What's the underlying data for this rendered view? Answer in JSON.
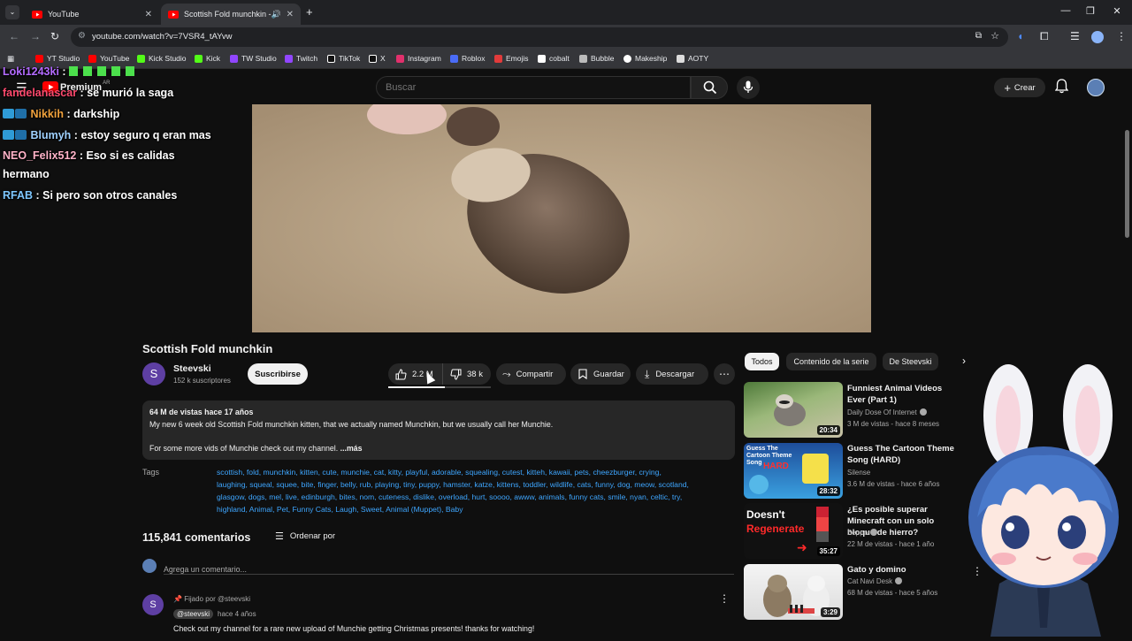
{
  "browser": {
    "tabs": [
      {
        "label": "YouTube"
      },
      {
        "label": "Scottish Fold munchkin - Yo"
      }
    ],
    "url": "youtube.com/watch?v=7VSR4_tAYvw",
    "bookmarks": [
      {
        "label": "YT Studio",
        "color": "#ff0000"
      },
      {
        "label": "YouTube",
        "color": "#ff0000"
      },
      {
        "label": "Kick Studio",
        "color": "#53fc18"
      },
      {
        "label": "Kick",
        "color": "#53fc18"
      },
      {
        "label": "TW Studio",
        "color": "#9146ff"
      },
      {
        "label": "Twitch",
        "color": "#9146ff"
      },
      {
        "label": "TikTok",
        "color": "#ffffff"
      },
      {
        "label": "X",
        "color": "#ffffff"
      },
      {
        "label": "Instagram",
        "color": "#e1306c"
      },
      {
        "label": "Roblox",
        "color": "#4a6cf7"
      },
      {
        "label": "Emojis",
        "color": "#e23b3b"
      },
      {
        "label": "cobalt",
        "color": "#ffffff"
      },
      {
        "label": "Bubble",
        "color": "#bbbbbb"
      },
      {
        "label": "Makeship",
        "color": "#ffffff"
      },
      {
        "label": "AOTY",
        "color": "#dddddd"
      }
    ]
  },
  "header": {
    "logo": "Premium",
    "logo_country": "AR",
    "search_placeholder": "Buscar",
    "create_label": "Crear"
  },
  "chat": [
    {
      "user": "Loki1243ki",
      "message": "",
      "color": "#b36bff",
      "badges": 0
    },
    {
      "user": "fandelanascar",
      "message": "se murió la saga",
      "color": "#ff4a6e",
      "badges": 0
    },
    {
      "user": "Nikkih",
      "message": "darkship",
      "color": "#f0a13c",
      "badges": 2
    },
    {
      "user": "Blumyh",
      "message": "estoy seguro q eran mas",
      "color": "#9fd1ff",
      "badges": 2
    },
    {
      "user": "NEO_Felix512",
      "message": "Eso si es calidas",
      "color": "#ffb3c8",
      "badges": 0
    },
    {
      "user": "",
      "message": "hermano",
      "color": "#ffffff",
      "badges": 0
    },
    {
      "user": "RFAB",
      "message": "Si pero son otros canales",
      "color": "#7ec7ff",
      "badges": 0
    }
  ],
  "video": {
    "title": "Scottish Fold munchkin",
    "channel": "Steevski",
    "channel_initial": "S",
    "subscribers": "152 k suscriptores",
    "subscribe_label": "Suscribirse",
    "likes": "2.2 M",
    "dislikes": "38 k",
    "share_label": "Compartir",
    "save_label": "Guardar",
    "download_label": "Descargar"
  },
  "description": {
    "meta": "64 M de vistas  hace 17 años",
    "line1": "My new 6 week old Scottish Fold munchkin kitten, that we actually named Munchkin, but we usually call her Munchie.",
    "line2": "For some more vids of Munchie check out my channel.",
    "more_label": "...más"
  },
  "tags": {
    "label": "Tags",
    "lines": [
      "scottish, fold, munchkin, kitten, cute, munchie, cat, kitty, playful, adorable, squealing, cutest, kitteh, kawaii, pets, cheezburger, crying,",
      "laughing, squeal, squee, bite, finger, belly, rub, playing, tiny, puppy, hamster, katze, kittens, toddler, wildlife, cats, funny, dog, meow, scotland,",
      "glasgow, dogs, mel, live, edinburgh, bites, nom, cuteness, dislike, overload, hurt, soooo, awww, animals, funny cats, smile, nyan, celtic, try,",
      "highland, Animal, Pet, Funny Cats, Laugh, Sweet, Animal (Muppet), Baby"
    ]
  },
  "comments": {
    "count_label": "115,841 comentarios",
    "sort_label": "Ordenar por",
    "add_placeholder": "Agrega un comentario...",
    "pinned": {
      "pinned_label": "Fijado por @steevski",
      "author": "@steevski",
      "time": "hace 4 años",
      "text": "Check out my channel for a rare new upload of Munchie getting Christmas presents!   thanks for watching!"
    }
  },
  "sidebar": {
    "chips": [
      "Todos",
      "Contenido de la serie",
      "De Steevski"
    ],
    "videos": [
      {
        "title": "Funniest Animal Videos Ever (Part 1)",
        "channel": "Daily Dose Of Internet",
        "meta": "3 M de vistas - hace 8 meses",
        "duration": "20:34",
        "verified": true
      },
      {
        "title": "Guess The Cartoon Theme Song (HARD)",
        "channel": "Silense",
        "meta": "3.6 M de vistas - hace 6 años",
        "duration": "28:32",
        "verified": false,
        "thumb_text": "Guess The Cartoon Theme Song",
        "thumb_text2": "HARD"
      },
      {
        "title": "¿Es posible superar Minecraft con un solo bloque de hierro?",
        "channel": "Beppo",
        "meta": "22 M de vistas - hace 1 año",
        "duration": "35:27",
        "verified": true,
        "thumb_text": "Doesn't",
        "thumb_text2": "Regenerate"
      },
      {
        "title": "Gato y domino",
        "channel": "Cat Navi Desk",
        "meta": "68 M de vistas - hace 5 años",
        "duration": "3:29",
        "verified": true
      }
    ]
  }
}
